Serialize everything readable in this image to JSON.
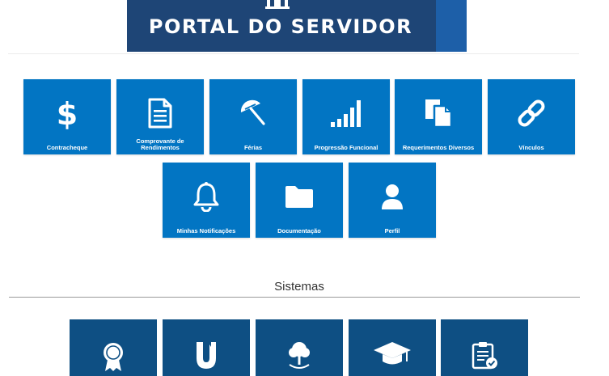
{
  "header": {
    "title": "PORTAL DO SERVIDOR",
    "back_icon": "chevron-left-icon",
    "accent_color": "#f5d80d",
    "banner_color": "#1e4576"
  },
  "services": {
    "tile_color": "#0275c3",
    "items": [
      {
        "label": "Contracheque",
        "icon": "dollar-icon"
      },
      {
        "label": "Comprovante de Rendimentos",
        "icon": "document-icon"
      },
      {
        "label": "Férias",
        "icon": "beach-umbrella-icon"
      },
      {
        "label": "Progressão Funcional",
        "icon": "signal-bars-icon"
      },
      {
        "label": "Requerimentos Diversos",
        "icon": "copy-documents-icon"
      },
      {
        "label": "Vínculos",
        "icon": "link-icon"
      },
      {
        "label": "Minhas Notificações",
        "icon": "bell-icon"
      },
      {
        "label": "Documentação",
        "icon": "folder-icon"
      },
      {
        "label": "Perfil",
        "icon": "user-icon"
      }
    ]
  },
  "systems": {
    "title": "Sistemas",
    "tile_color": "#0e4f83",
    "items": [
      {
        "icon": "award-ribbon-icon"
      },
      {
        "icon": "u-logo-icon"
      },
      {
        "icon": "tree-icon"
      },
      {
        "icon": "graduation-cap-icon"
      },
      {
        "icon": "clipboard-check-icon"
      }
    ]
  }
}
